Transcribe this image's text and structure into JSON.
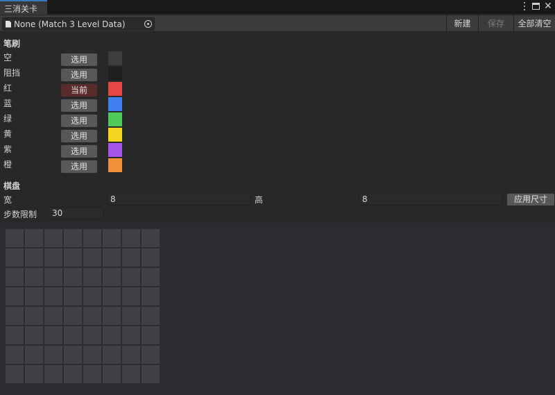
{
  "tab": {
    "title": "三消关卡"
  },
  "toolbar": {
    "object_field": "None (Match 3 Level Data)",
    "new_label": "新建",
    "save_label": "保存",
    "clear_label": "全部清空"
  },
  "brush": {
    "title": "笔刷",
    "select_label": "选用",
    "current_label": "当前",
    "items": [
      {
        "label": "空",
        "color": "#3d3d3f",
        "active": false
      },
      {
        "label": "阻挡",
        "color": "#1f1f1f",
        "active": false
      },
      {
        "label": "红",
        "color": "#e84545",
        "active": true
      },
      {
        "label": "蓝",
        "color": "#3f7ff0",
        "active": false
      },
      {
        "label": "绿",
        "color": "#4fc95a",
        "active": false
      },
      {
        "label": "黄",
        "color": "#f2d51e",
        "active": false
      },
      {
        "label": "紫",
        "color": "#a454e8",
        "active": false
      },
      {
        "label": "橙",
        "color": "#f0913a",
        "active": false
      }
    ]
  },
  "board": {
    "title": "棋盘",
    "width_label": "宽",
    "width_value": "8",
    "height_label": "高",
    "height_value": "8",
    "apply_label": "应用尺寸",
    "steps_label": "步数限制",
    "steps_value": "30"
  },
  "grid": {
    "rows": 8,
    "cols": 8,
    "cell_color": "#404045"
  }
}
